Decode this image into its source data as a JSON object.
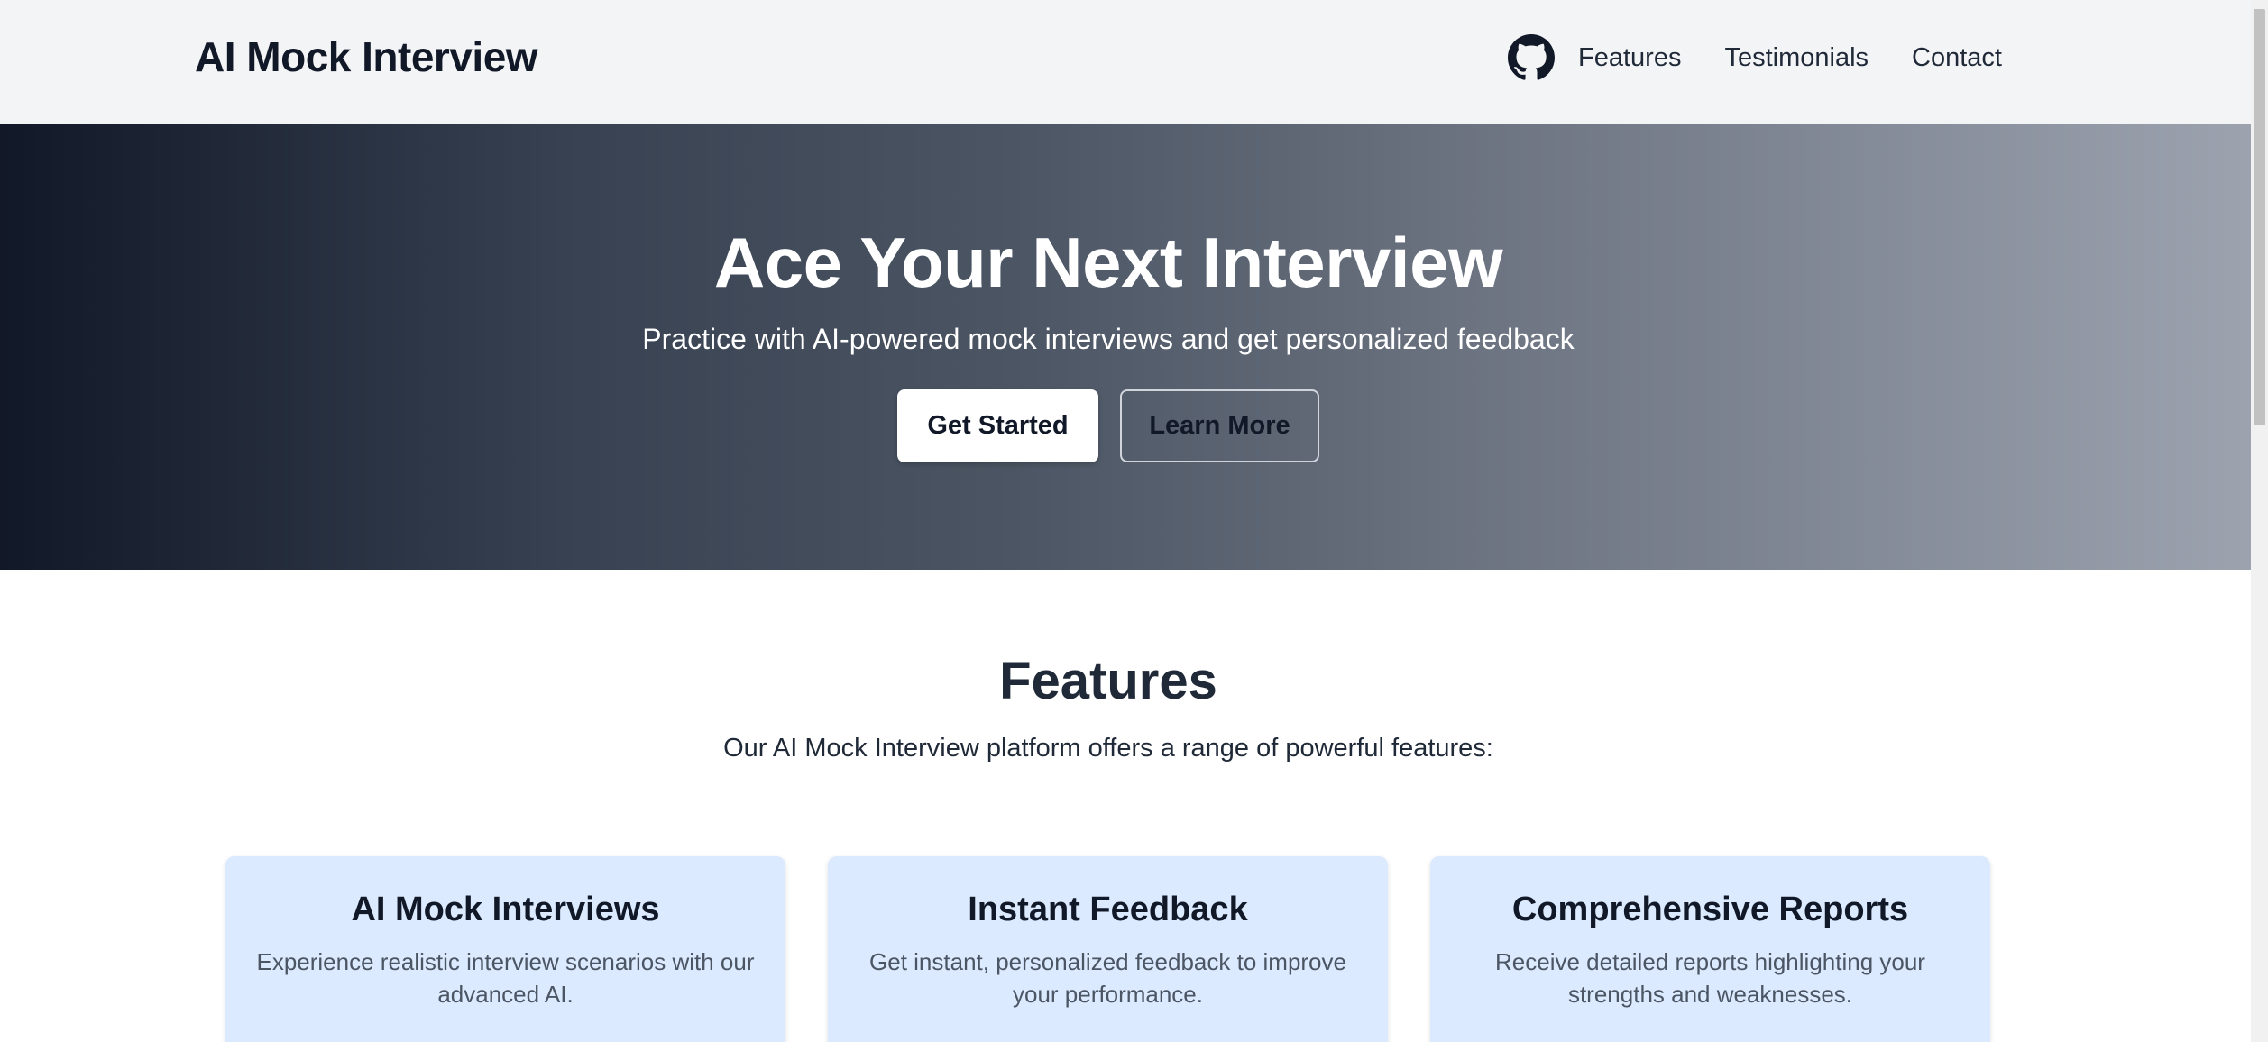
{
  "header": {
    "brand": "AI Mock Interview",
    "github_icon": "github-icon",
    "nav": [
      "Features",
      "Testimonials",
      "Contact"
    ]
  },
  "hero": {
    "title": "Ace Your Next Interview",
    "subtitle": "Practice with AI-powered mock interviews and get personalized feedback",
    "primary_button": "Get Started",
    "secondary_button": "Learn More"
  },
  "features": {
    "title": "Features",
    "subtitle": "Our AI Mock Interview platform offers a range of powerful features:",
    "cards": [
      {
        "title": "AI Mock Interviews",
        "description": "Experience realistic interview scenarios with our advanced AI."
      },
      {
        "title": "Instant Feedback",
        "description": "Get instant, personalized feedback to improve your performance."
      },
      {
        "title": "Comprehensive Reports",
        "description": "Receive detailed reports highlighting your strengths and weaknesses."
      }
    ]
  },
  "colors": {
    "hero_gradient_start": "#111827",
    "hero_gradient_end": "#9ca3af",
    "card_background": "#dbeafe",
    "header_background": "#f3f4f6"
  }
}
